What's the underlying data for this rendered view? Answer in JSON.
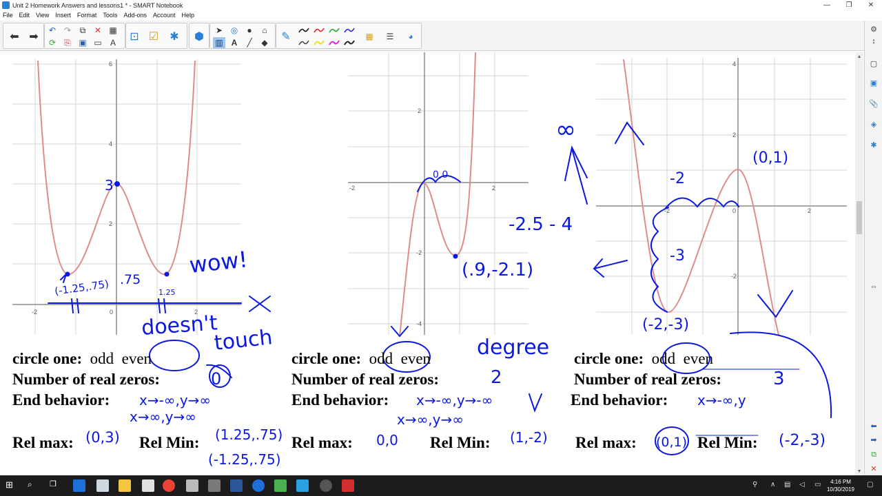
{
  "window": {
    "title": "Unit 2 Homework Answers and lessons1 * - SMART Notebook",
    "controls": [
      "—",
      "❐",
      "✕"
    ]
  },
  "menu": [
    "File",
    "Edit",
    "View",
    "Insert",
    "Format",
    "Tools",
    "Add-ons",
    "Account",
    "Help"
  ],
  "colors": {
    "ink": "#0a18e0",
    "curve": "#e08a8a",
    "grid": "#d6d6d6",
    "axis": "#8a8a8a"
  },
  "graphs": [
    {
      "x_ticks": [
        "-2",
        "0",
        "2"
      ],
      "y_ticks": [
        "2",
        "4",
        "6"
      ]
    },
    {
      "x_ticks": [
        "-2",
        "2"
      ],
      "y_ticks": [
        "2",
        "-2",
        "-4"
      ]
    },
    {
      "x_ticks": [
        "-2",
        "0",
        "2"
      ],
      "y_ticks": [
        "4",
        "2",
        "-2"
      ]
    }
  ],
  "questions": [
    {
      "circle_label": "circle one:",
      "opt_odd": "odd",
      "opt_even": "even",
      "zeros_label": "Number of real zeros:",
      "end_label": "End behavior:",
      "max_label": "Rel max:",
      "min_label": "Rel Min:"
    },
    {
      "circle_label": "circle one:",
      "opt_odd": "odd",
      "opt_even": "even",
      "zeros_label": "Number of real zeros:",
      "end_label": "End behavior:",
      "max_label": "Rel max:",
      "min_label": "Rel Min:"
    },
    {
      "circle_label": "circle one:",
      "opt_odd": "odd",
      "opt_even": "even",
      "zeros_label": "Number of real zeros:",
      "end_label": "End behavior:",
      "max_label": "Rel max:",
      "min_label": "Rel Min:"
    }
  ],
  "handwriting": {
    "g1_point": "3",
    "g1_left_min": "(-1.25,.75)",
    "g1_mid": ".75",
    "g1_right_min": "1.25",
    "g1_wow": "wow!",
    "g1_doesnt": "doesn't",
    "g1_touch": "touch",
    "g1_zeros": "0",
    "g1_end1": "x→-∞,y→∞",
    "g1_end2": "x→∞,y→∞",
    "g1_max": "(0,3)",
    "g1_min1": "(1.25,.75)",
    "g1_min2": "(-1.25,.75)",
    "g2_top": "0,0",
    "g2_min_pt": "(.9,-2.1)",
    "g2_zeros": "2",
    "g2_end1": "x→-∞,y→-∞",
    "g2_end2": "x→∞,y→∞",
    "g2_max": "0,0",
    "g2_min": "(1,-2)",
    "g2_degree": "degree",
    "g3_inf": "∞",
    "g3_neg": "-2.5 - 4",
    "g3_pt1": "(0,1)",
    "g3_m2": "-2",
    "g3_m3": "-3",
    "g3_min_pt": "(-2,-3)",
    "g3_zeros": "3",
    "g3_end": "x→-∞,y",
    "g3_max": "(0,1)",
    "g3_min": "(-2,-3)"
  },
  "taskbar": {
    "time": "4:16 PM",
    "date": "10/30/2019"
  }
}
